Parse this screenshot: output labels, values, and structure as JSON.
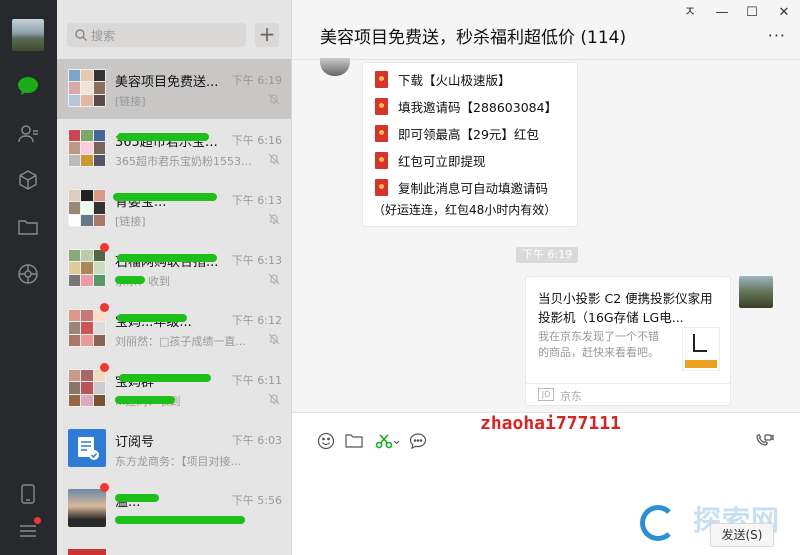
{
  "search": {
    "placeholder": "搜索"
  },
  "chats": [
    {
      "name": "美容项目免费送...",
      "time": "下午 6:19",
      "preview": "[链接]",
      "active": true,
      "badge": false
    },
    {
      "name": "365超市君乐宝奶...",
      "time": "下午 6:16",
      "preview": "365超市君乐宝奶粉1553...",
      "active": false,
      "badge": false
    },
    {
      "name": "育婴宝...",
      "time": "下午 6:13",
      "preview": "[链接]",
      "active": false,
      "badge": false
    },
    {
      "name": "石榴网购联合指...",
      "time": "下午 6:13",
      "preview": "京东：收到",
      "active": false,
      "badge": true
    },
    {
      "name": "宝妈...年级...",
      "time": "下午 6:12",
      "preview": "刘丽然：□孩子成绩一直...",
      "active": false,
      "badge": true
    },
    {
      "name": "宝妈群",
      "time": "下午 6:11",
      "preview": "...建同：收到",
      "active": false,
      "badge": true
    },
    {
      "name": "订阅号",
      "time": "下午 6:03",
      "preview": "东方龙商务：【项目对接...",
      "active": false,
      "badge": false
    },
    {
      "name": "温...",
      "time": "下午 5:56",
      "preview": "...",
      "active": false,
      "badge": true
    }
  ],
  "conversation": {
    "title": "美容项目免费送，秒杀福利超低价 (114)",
    "redpacket_lines": [
      "下载【火山极速版】",
      "填我邀请码【288603084】",
      "即可领最高【29元】红包",
      "红包可立即提现",
      "复制此消息可自动填邀请码"
    ],
    "redpacket_footer": "（好运连连，红包48小时内有效）",
    "time_tag": "下午 6:19",
    "card": {
      "title": "当贝小投影 C2 便携投影仪家用投影机（16G存储 LG电...",
      "desc": "我在京东发现了一个不错的商品，赶快来看看吧。",
      "source": "京东",
      "logo": "JD"
    }
  },
  "input": {
    "overlay_text": "zhaohai777111",
    "send_label": "发送(S)"
  },
  "window": {
    "pin": "ㅈ",
    "minimize": "—",
    "maximize": "☐",
    "close": "✕",
    "more": "···"
  },
  "watermark": "探索网",
  "colors": {
    "accent_green": "#1aad19",
    "badge_red": "#f43530",
    "rail": "#28292c",
    "overlay_red": "#e02020"
  }
}
